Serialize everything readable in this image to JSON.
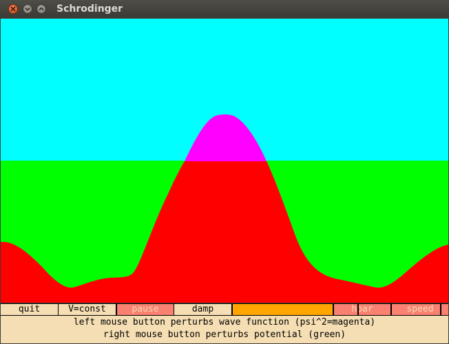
{
  "window": {
    "title": "Schrodinger",
    "close_icon": "close-icon",
    "minimize_icon": "minimize-icon",
    "maximize_icon": "maximize-icon"
  },
  "colors": {
    "background": "#00ffff",
    "potential": "#00ff00",
    "wave": "#ff0000",
    "psi_squared": "#ff00ff",
    "button_light": "#f5deb3",
    "button_active": "#fa8072",
    "slider": "#ffa500"
  },
  "buttons": {
    "quit": "quit",
    "v_const": "V=const",
    "pause": "pause",
    "damp": "damp",
    "hbar": "hbar",
    "speed": "speed"
  },
  "status": {
    "line1": "left mouse button perturbs wave function (psi^2=magenta)",
    "line2": "right mouse button perturbs potential (green)"
  }
}
